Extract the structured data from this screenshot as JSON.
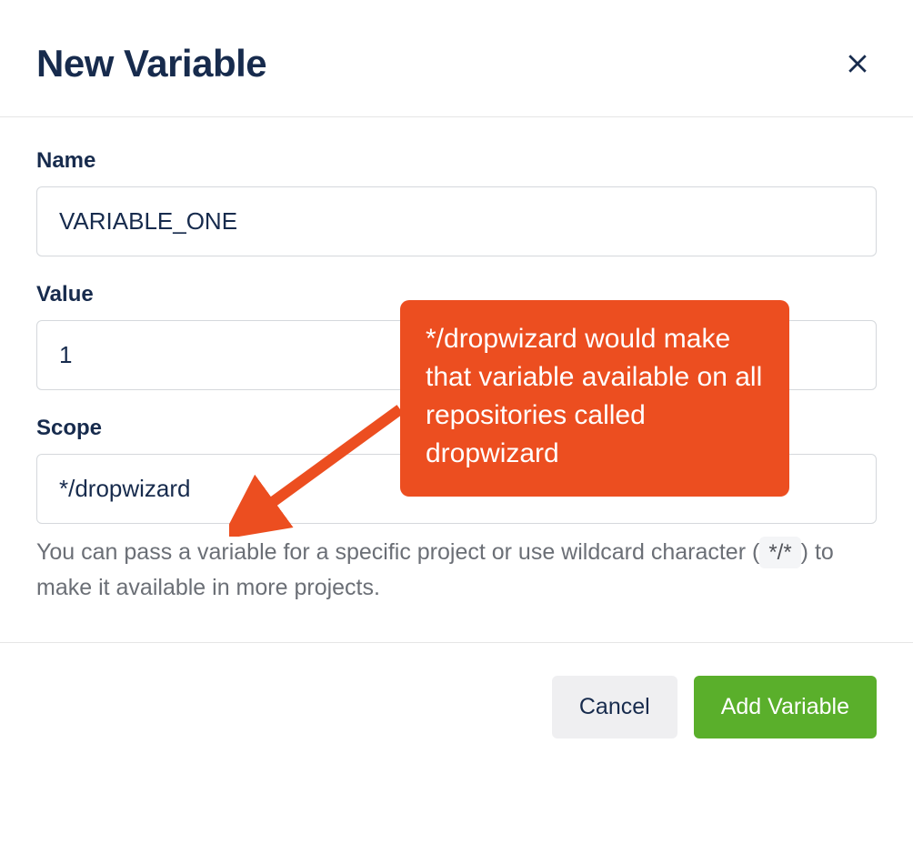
{
  "dialog": {
    "title": "New Variable"
  },
  "fields": {
    "name": {
      "label": "Name",
      "value": "VARIABLE_ONE"
    },
    "value": {
      "label": "Value",
      "value": "1"
    },
    "scope": {
      "label": "Scope",
      "value": "*/dropwizard"
    }
  },
  "help": {
    "prefix": "You can pass a variable for a specific project or use wildcard character (",
    "code": "*/*",
    "suffix": ") to make it available in more projects."
  },
  "buttons": {
    "cancel": "Cancel",
    "submit": "Add Variable"
  },
  "callout": {
    "text": "*/dropwizard would make that variable available on all repositories called dropwizard"
  },
  "colors": {
    "callout": "#ec4e20",
    "primary": "#5aaf2b"
  }
}
